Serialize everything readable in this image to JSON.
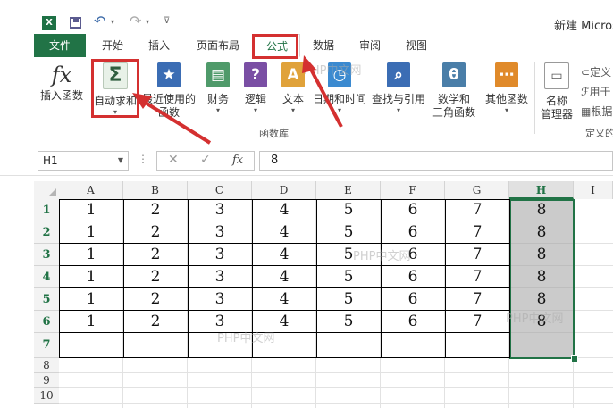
{
  "app": {
    "icon_text": "X",
    "title": "新建 Micros"
  },
  "tabs": [
    "文件",
    "开始",
    "插入",
    "页面布局",
    "公式",
    "数据",
    "审阅",
    "视图"
  ],
  "ribbon": {
    "insert_function": "插入函数",
    "autosum_line1": "自动求和",
    "recent_line1": "最近使用的",
    "recent_line2": "函数",
    "finance": "财务",
    "logic": "逻辑",
    "text": "文本",
    "datetime": "日期和时间",
    "lookup": "查找与引用",
    "math_line1": "数学和",
    "math_line2": "三角函数",
    "other": "其他函数",
    "name_mgr_line1": "名称",
    "name_mgr_line2": "管理器",
    "group_label": "函数库",
    "define_name": "定义",
    "use_in_formula": "用于",
    "create_from_sel": "根据",
    "defined_group": "定义的"
  },
  "formula_bar": {
    "name_box": "H1",
    "value": "8"
  },
  "sheet": {
    "columns": [
      "A",
      "B",
      "C",
      "D",
      "E",
      "F",
      "G",
      "H",
      "I"
    ],
    "rows": [
      "1",
      "2",
      "3",
      "4",
      "5",
      "6",
      "7",
      "8",
      "9",
      "10"
    ],
    "data": [
      [
        "1",
        "2",
        "3",
        "4",
        "5",
        "6",
        "7",
        "8"
      ],
      [
        "1",
        "2",
        "3",
        "4",
        "5",
        "6",
        "7",
        "8"
      ],
      [
        "1",
        "2",
        "3",
        "4",
        "5",
        "6",
        "7",
        "8"
      ],
      [
        "1",
        "2",
        "3",
        "4",
        "5",
        "6",
        "7",
        "8"
      ],
      [
        "1",
        "2",
        "3",
        "4",
        "5",
        "6",
        "7",
        "8"
      ],
      [
        "1",
        "2",
        "3",
        "4",
        "5",
        "6",
        "7",
        "8"
      ]
    ],
    "selected_column": "H"
  },
  "watermark": "PHP中文网",
  "colors": {
    "accent": "#217346",
    "highlight": "#d43030"
  }
}
